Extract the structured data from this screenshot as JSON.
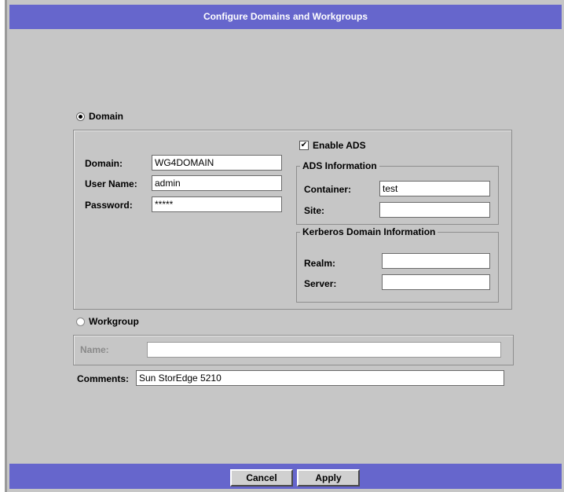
{
  "window": {
    "title": "Configure Domains and Workgroups"
  },
  "domain_option": {
    "label": "Domain",
    "selected": true,
    "domain_label": "Domain:",
    "domain_value": "WG4DOMAIN",
    "username_label": "User Name:",
    "username_value": "admin",
    "password_label": "Password:",
    "password_value": "*****"
  },
  "ads": {
    "enable_label": "Enable ADS",
    "enabled": true,
    "checkmark": "✔",
    "info_title": "ADS Information",
    "container_label": "Container:",
    "container_value": "test",
    "site_label": "Site:",
    "site_value": ""
  },
  "kerberos": {
    "title": "Kerberos Domain Information",
    "realm_label": "Realm:",
    "realm_value": "",
    "server_label": "Server:",
    "server_value": ""
  },
  "workgroup_option": {
    "label": "Workgroup",
    "selected": false,
    "name_label": "Name:",
    "name_value": ""
  },
  "comments": {
    "label": "Comments:",
    "value": "Sun StorEdge 5210"
  },
  "footer": {
    "cancel_label": "Cancel",
    "apply_label": "Apply"
  },
  "colors": {
    "titlebar": "#6666cc",
    "background": "#c6c6c6"
  }
}
